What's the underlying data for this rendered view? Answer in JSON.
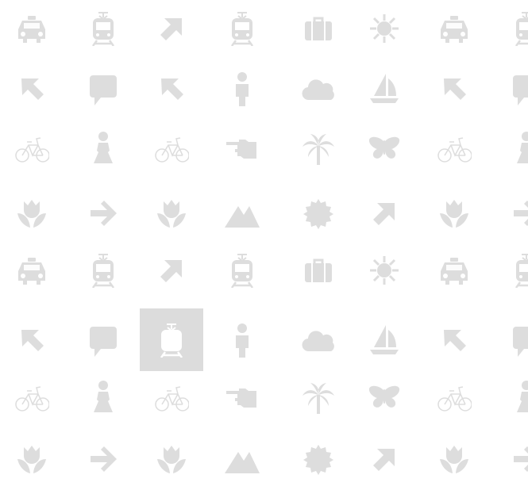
{
  "icon_grid": {
    "selected": "5-2",
    "colors": {
      "icon": "#dddddd",
      "selected_background": "#dcdcdc",
      "selected_icon": "#ffffff",
      "background": "#ffffff"
    },
    "rows": [
      [
        "taxi-icon",
        "train-icon",
        "arrow-up-right-icon",
        "train-icon",
        "suitcase-icon",
        "sun-icon",
        "taxi-icon",
        "train-icon"
      ],
      [
        "arrow-up-left-icon",
        "speech-bubble-icon",
        "arrow-up-left-icon",
        "man-icon",
        "cloud-icon",
        "sailboat-icon",
        "arrow-up-left-icon",
        "speech-bubble-icon"
      ],
      [
        "bicycle-icon",
        "woman-icon",
        "bicycle-icon",
        "pointing-hand-icon",
        "palm-tree-icon",
        "butterfly-icon",
        "bicycle-icon",
        "woman-icon"
      ],
      [
        "tulip-icon",
        "arrow-right-icon",
        "tulip-icon",
        "mountains-icon",
        "sun-badge-icon",
        "arrow-up-right-icon",
        "tulip-icon",
        "arrow-right-icon"
      ],
      [
        "taxi-icon",
        "train-icon",
        "arrow-up-right-icon",
        "train-icon",
        "suitcase-icon",
        "sun-icon",
        "taxi-icon",
        "train-icon"
      ],
      [
        "arrow-up-left-icon",
        "speech-bubble-icon",
        "train-icon",
        "man-icon",
        "cloud-icon",
        "sailboat-icon",
        "arrow-up-left-icon",
        "speech-bubble-icon"
      ],
      [
        "bicycle-icon",
        "woman-icon",
        "bicycle-icon",
        "pointing-hand-icon",
        "palm-tree-icon",
        "butterfly-icon",
        "bicycle-icon",
        "woman-icon"
      ],
      [
        "tulip-icon",
        "arrow-right-icon",
        "tulip-icon",
        "mountains-icon",
        "sun-badge-icon",
        "arrow-up-right-icon",
        "tulip-icon",
        "arrow-right-icon"
      ]
    ]
  }
}
